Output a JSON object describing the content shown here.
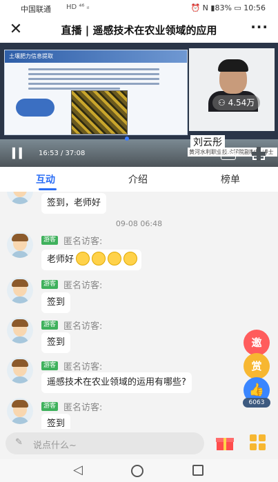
{
  "status_bar": {
    "carrier": "中国联通",
    "signal_icons": "HD ⁴⁶ ᵢₗ",
    "right_text": "⏰ N ▮83% ▭ 10:56"
  },
  "header": {
    "close_icon": "close-icon",
    "title": "直播 | 遥感技术在农业领域的应用",
    "more_icon": "more-icon"
  },
  "video": {
    "slide_heading": "土壤肥力信息提取",
    "viewers": "4.54万",
    "speaker_name": "刘云彤",
    "speaker_title": "黄河水利职业技术学院副教授  博士",
    "time": "16:53 / 37:08",
    "danmu_label": "弹"
  },
  "tabs": [
    {
      "label": "互动",
      "active": true
    },
    {
      "label": "介绍",
      "active": false
    },
    {
      "label": "榜单",
      "active": false
    }
  ],
  "chat": {
    "timestamp": "09-08 06:48",
    "guest_tag": "游客",
    "nickname": "匿名访客:",
    "messages": [
      {
        "text": "签到，老师好"
      },
      {
        "text": "老师好"
      },
      {
        "text": "签到"
      },
      {
        "text": "签到"
      },
      {
        "text": "遥感技术在农业领域的运用有哪些?"
      },
      {
        "text": "签到"
      }
    ]
  },
  "floating": {
    "invite_label": "邀",
    "reward_label": "赏",
    "like_icon": "thumbs-up-icon",
    "like_count": "6063"
  },
  "input_bar": {
    "placeholder": "说点什么~",
    "gift_icon": "gift-icon",
    "apps_icon": "apps-grid-icon"
  },
  "colors": {
    "accent": "#2a6df5",
    "guest_tag": "#3fb15c",
    "invite": "#ff5c5c",
    "reward": "#f7b731",
    "like": "#3a86ff"
  }
}
